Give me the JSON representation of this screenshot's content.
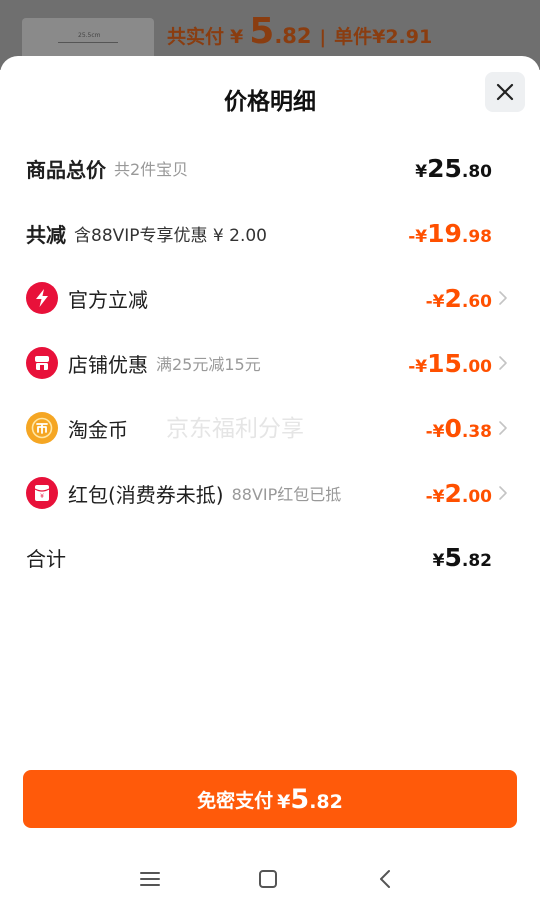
{
  "background": {
    "thumb_text": "25.5cm",
    "total_label": "共实付",
    "total_currency": "¥",
    "total_int": "5",
    "total_dec": ".82",
    "separator": "|",
    "unit_label": "单件¥2.91"
  },
  "sheet": {
    "title": "价格明细"
  },
  "rows": {
    "total": {
      "label": "商品总价",
      "sub": "共2件宝贝",
      "amount": {
        "cur": "¥",
        "int": "25",
        "dec": ".80"
      }
    },
    "reduction": {
      "label": "共减",
      "sub": "含88VIP专享优惠 ¥ 2.00",
      "amount": {
        "cur": "-¥",
        "int": "19",
        "dec": ".98"
      }
    },
    "official": {
      "label": "官方立减",
      "amount": {
        "cur": "-¥",
        "int": "2",
        "dec": ".60"
      }
    },
    "shop": {
      "label": "店铺优惠",
      "sub": "满25元减15元",
      "amount": {
        "cur": "-¥",
        "int": "15",
        "dec": ".00"
      }
    },
    "coin": {
      "label": "淘金币",
      "amount": {
        "cur": "-¥",
        "int": "0",
        "dec": ".38"
      }
    },
    "redpacket": {
      "label": "红包(消费券未抵)",
      "sub": "88VIP红包已抵",
      "amount": {
        "cur": "-¥",
        "int": "2",
        "dec": ".00"
      }
    },
    "sum": {
      "label": "合计",
      "amount": {
        "cur": "¥",
        "int": "5",
        "dec": ".82"
      }
    }
  },
  "pay_button": {
    "label": "免密支付",
    "cur": "¥",
    "int": "5",
    "dec": ".82"
  },
  "watermark": "京东福利分享",
  "colors": {
    "accent": "#ff5000",
    "button": "#ff5a0a",
    "official_icon": "#e8113a",
    "shop_icon": "#e8113a",
    "coin_icon": "#f5a623",
    "redpacket_icon": "#e8113a"
  },
  "icons": {
    "close": "close-icon",
    "official": "lightning-icon",
    "shop": "shop-icon",
    "coin": "coin-icon",
    "redpacket": "red-packet-icon",
    "nav_menu": "menu-icon",
    "nav_home": "home-icon",
    "nav_back": "back-icon"
  }
}
